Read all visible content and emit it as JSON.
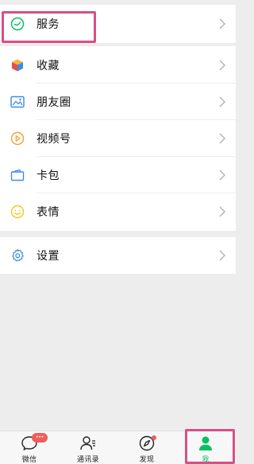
{
  "menu": {
    "service": "服务",
    "favorites": "收藏",
    "moments": "朋友圈",
    "channels": "视频号",
    "cards": "卡包",
    "stickers": "表情",
    "settings": "设置"
  },
  "tabbar": {
    "chats": "微信",
    "chats_badge": "···",
    "contacts": "通讯录",
    "discover": "发现",
    "me": "我"
  },
  "colors": {
    "accent_green": "#07c160",
    "highlight_pink": "#d94f86",
    "badge_red": "#f25b5b",
    "background": "#ededed"
  }
}
